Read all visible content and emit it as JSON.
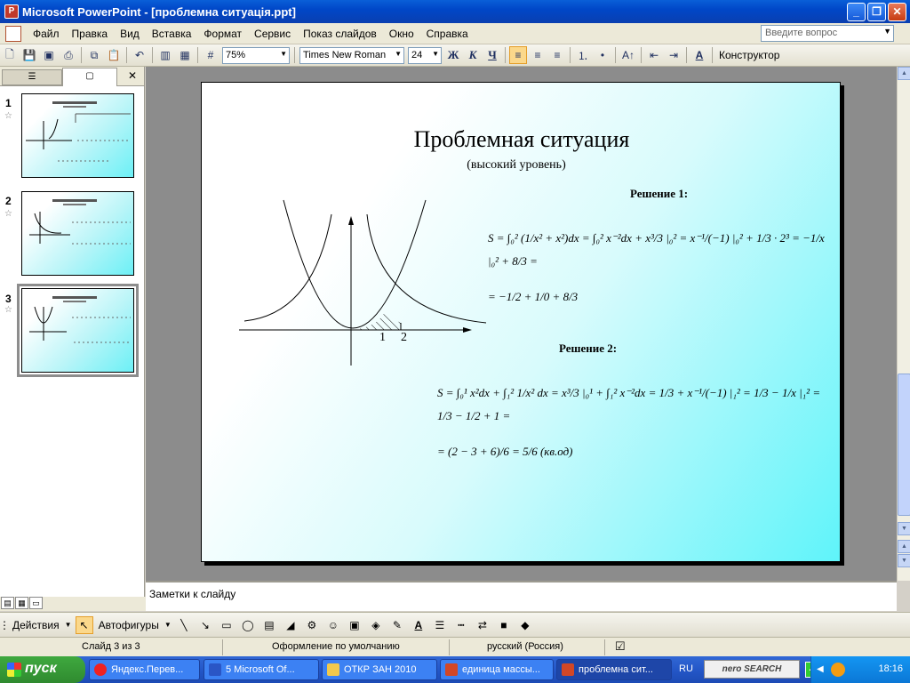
{
  "window": {
    "title": "Microsoft PowerPoint - [проблемна ситуація.ppt]"
  },
  "menu": {
    "items": [
      "Файл",
      "Правка",
      "Вид",
      "Вставка",
      "Формат",
      "Сервис",
      "Показ слайдов",
      "Окно",
      "Справка"
    ],
    "ask_placeholder": "Введите вопрос"
  },
  "toolbar": {
    "zoom": "75%",
    "font": "Times New Roman",
    "font_size": "24",
    "bold": "Ж",
    "italic": "К",
    "underline": "Ч",
    "designer": "Конструктор"
  },
  "slide_pane": {
    "slides": [
      {
        "number": "1"
      },
      {
        "number": "2"
      },
      {
        "number": "3",
        "selected": true
      }
    ]
  },
  "slide": {
    "title": "Проблемная ситуация",
    "subtitle": "(высокий уровень)",
    "solution1_heading": "Решение 1:",
    "solution2_heading": "Решение 2:",
    "tick_1": "1",
    "tick_2": "2",
    "formula1_line1": "S = ∫₀² (1/x² + x²)dx = ∫₀² x⁻²dx + x³/3 |₀² = x⁻¹/(−1) |₀² + 1/3 · 2³ = −1/x |₀² + 8/3 =",
    "formula1_line2": "= −1/2 + 1/0 + 8/3",
    "formula2_line1": "S = ∫₀¹ x²dx + ∫₁² 1/x² dx = x³/3 |₀¹ + ∫₁² x⁻²dx = 1/3 + x⁻¹/(−1) |₁² = 1/3 − 1/x |₁² = 1/3 − 1/2 + 1 =",
    "formula2_line2": "= (2 − 3 + 6)/6 = 5/6  (кв.од)"
  },
  "notes": {
    "placeholder": "Заметки к слайду"
  },
  "drawing_toolbar": {
    "actions": "Действия",
    "autoshapes": "Автофигуры"
  },
  "status": {
    "slide": "Слайд 3 из 3",
    "design": "Оформление по умолчанию",
    "language": "русский (Россия)"
  },
  "taskbar": {
    "start": "пуск",
    "tasks": [
      "Яндекс.Перев...",
      "5 Microsoft Of...",
      "ОТКР ЗАН 2010",
      "единица массы...",
      "проблемна сит..."
    ],
    "lang": "RU",
    "search": "nero SEARCH",
    "clock": "18:16"
  },
  "colors": {
    "titlebar": "#0a5fd8",
    "slide_gradient_end": "#5ff4fa",
    "taskbar": "#2457c8",
    "start": "#3fa93f"
  }
}
